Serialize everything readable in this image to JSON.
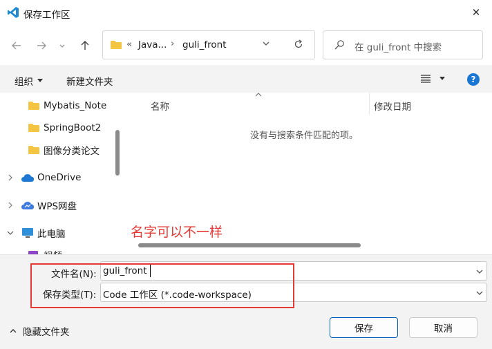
{
  "window": {
    "title": "保存工作区",
    "close_label": "✕"
  },
  "address": {
    "overflow": "«",
    "crumbs": [
      "Java...",
      "guli_front"
    ],
    "separator": "›"
  },
  "search": {
    "placeholder": "在 guli_front 中搜索"
  },
  "toolbar": {
    "organize_label": "组织",
    "new_folder_label": "新建文件夹",
    "help_label": "?"
  },
  "sidebar": {
    "items": [
      {
        "label": "Mybatis_Note"
      },
      {
        "label": "SpringBoot2"
      },
      {
        "label": "图像分类论文"
      },
      {
        "label": "OneDrive"
      },
      {
        "label": "WPS网盘"
      },
      {
        "label": "此电脑"
      },
      {
        "label": "视频"
      }
    ]
  },
  "file_list": {
    "col_name": "名称",
    "col_date": "修改日期",
    "empty_message": "没有与搜索条件匹配的项。"
  },
  "annotation": {
    "text": "名字可以不一样",
    "color": "#e53935"
  },
  "form": {
    "filename_label": "文件名(N):",
    "filename_value": "guli_front",
    "filetype_label": "保存类型(T):",
    "filetype_value": "Code 工作区 (*.code-workspace)"
  },
  "footer": {
    "hide_folders_label": "隐藏文件夹",
    "save_label": "保存",
    "cancel_label": "取消"
  },
  "colors": {
    "accent": "#005fb8",
    "folder": "#f4c542",
    "help": "#1976d2"
  }
}
